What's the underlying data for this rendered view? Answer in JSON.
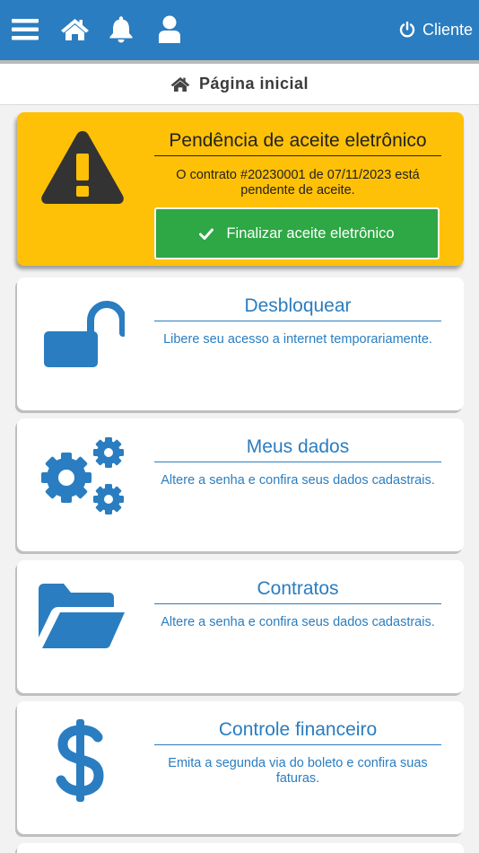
{
  "header": {
    "menu_icon": "hamburger-icon",
    "home_icon": "home-icon",
    "notifications_icon": "bell-icon",
    "profile_icon": "user-icon",
    "client_label": "Cliente",
    "client_icon": "power-icon"
  },
  "page": {
    "title": "Página inicial",
    "title_icon": "home-icon"
  },
  "alert_card": {
    "title": "Pendência de aceite eletrônico",
    "message": "O contrato #20230001 de 07/11/2023 está pendente de aceite.",
    "button_label": "Finalizar aceite eletrônico",
    "icon": "warning-icon",
    "button_icon": "check-icon"
  },
  "cards": [
    {
      "title": "Desbloquear",
      "description": "Libere seu acesso a internet temporariamente.",
      "icon": "unlock-icon"
    },
    {
      "title": "Meus dados",
      "description": "Altere a senha e confira seus dados cadastrais.",
      "icon": "gears-icon"
    },
    {
      "title": "Contratos",
      "description": "Altere a senha e confira seus dados cadastrais.",
      "icon": "folder-open-icon"
    },
    {
      "title": "Controle financeiro",
      "description": "Emita a segunda via do boleto e confira suas faturas.",
      "icon": "dollar-icon"
    }
  ],
  "colors": {
    "primary": "#2a7dc0",
    "alert": "#ffc107",
    "success": "#2ea745"
  }
}
